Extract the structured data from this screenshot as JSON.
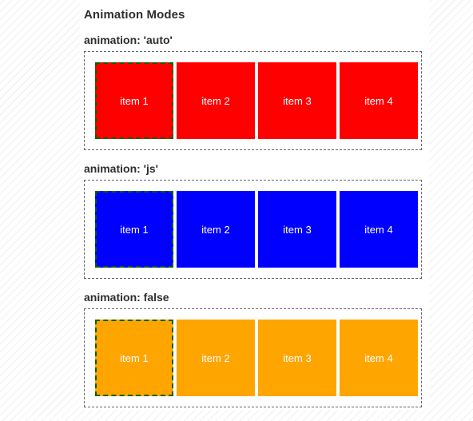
{
  "page": {
    "title": "Animation Modes",
    "background_pattern": "diagonal-stripes",
    "panel_background": "#ffffff"
  },
  "colors": {
    "heading_text": "#2e2e2e",
    "container_border": "#666666",
    "selected_border": "#006400",
    "item_label_text": "#ffffff",
    "red": "#FF0000",
    "blue": "#0000FF",
    "orange": "#FFA500"
  },
  "sections": [
    {
      "id": "auto",
      "title": "animation: 'auto'",
      "item_color": "#FF0000",
      "items": [
        {
          "label": "item 1",
          "selected": true
        },
        {
          "label": "item 2",
          "selected": false
        },
        {
          "label": "item 3",
          "selected": false
        },
        {
          "label": "item 4",
          "selected": false
        }
      ]
    },
    {
      "id": "js",
      "title": "animation: 'js'",
      "item_color": "#0000FF",
      "items": [
        {
          "label": "item 1",
          "selected": true
        },
        {
          "label": "item 2",
          "selected": false
        },
        {
          "label": "item 3",
          "selected": false
        },
        {
          "label": "item 4",
          "selected": false
        }
      ]
    },
    {
      "id": "false",
      "title": "animation: false",
      "item_color": "#FFA500",
      "items": [
        {
          "label": "item 1",
          "selected": true
        },
        {
          "label": "item 2",
          "selected": false
        },
        {
          "label": "item 3",
          "selected": false
        },
        {
          "label": "item 4",
          "selected": false
        }
      ]
    }
  ]
}
